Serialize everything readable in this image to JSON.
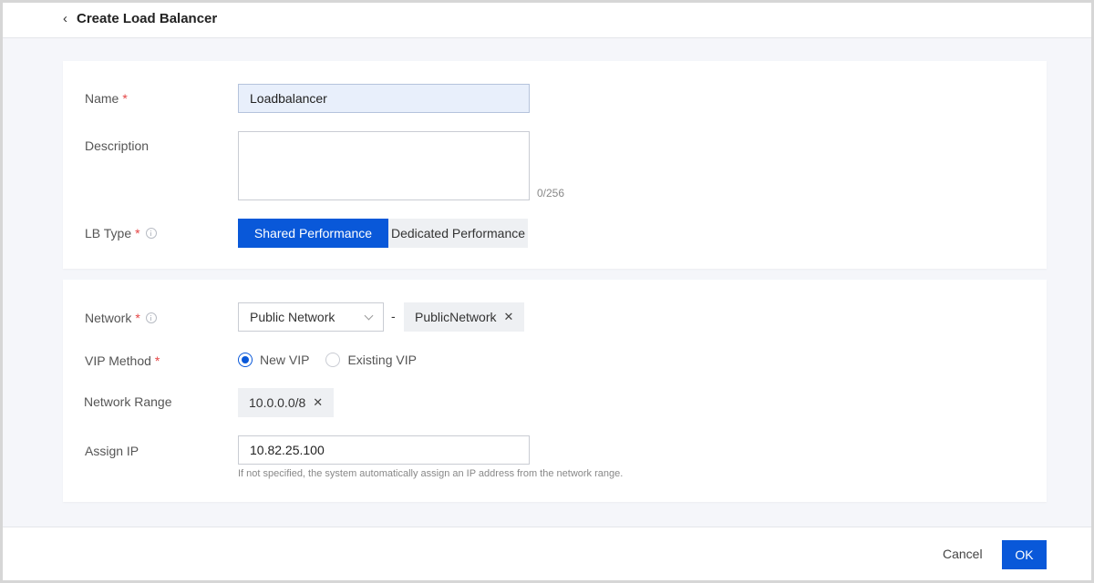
{
  "header": {
    "title": "Create Load Balancer",
    "back_icon": "chevron-left-icon"
  },
  "form": {
    "required_mark": "*",
    "name": {
      "label": "Name",
      "value": "Loadbalancer"
    },
    "description": {
      "label": "Description",
      "value": "",
      "counter": "0/256"
    },
    "lb_type": {
      "label": "LB Type",
      "options": [
        "Shared Performance",
        "Dedicated Performance"
      ],
      "selected": "Shared Performance"
    },
    "network": {
      "label": "Network",
      "select_value": "Public Network",
      "separator": "-",
      "tag": "PublicNetwork"
    },
    "vip_method": {
      "label": "VIP Method",
      "options": [
        "New VIP",
        "Existing VIP"
      ],
      "selected": "New VIP"
    },
    "network_range": {
      "label": "Network Range",
      "tag": "10.0.0.0/8"
    },
    "assign_ip": {
      "label": "Assign IP",
      "value": "10.82.25.100",
      "hint": "If not specified, the system automatically assign an IP address from the network range."
    }
  },
  "footer": {
    "cancel_label": "Cancel",
    "ok_label": "OK"
  },
  "colors": {
    "primary": "#0958d9",
    "required": "#e54545",
    "page_bg": "#f5f6fa"
  }
}
